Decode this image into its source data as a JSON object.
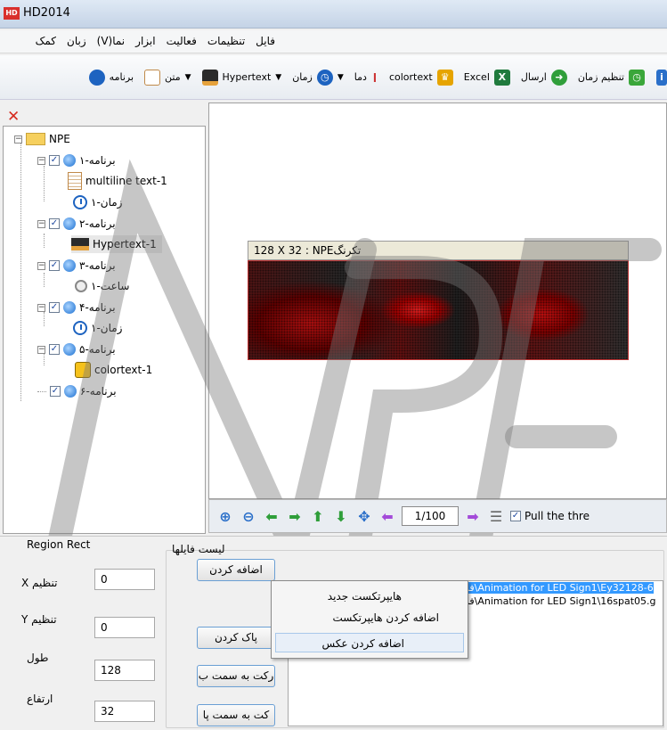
{
  "window": {
    "title": "HD2014",
    "icon_text": "HD"
  },
  "menu": [
    "فایل",
    "تنظیمات",
    "فعالیت",
    "ابزار",
    "نما(V)",
    "زبان",
    "کمک"
  ],
  "toolbar": [
    {
      "label": "تنظیم زمان",
      "icon": "clock-setting-icon",
      "color": "#3aa63a"
    },
    {
      "label": "ارسال",
      "icon": "send-icon",
      "color": "#2f9e3a"
    },
    {
      "label": "Excel",
      "icon": "excel-icon",
      "color": "#1f7a3d"
    },
    {
      "label": "colortext",
      "icon": "colortext-icon",
      "color": "#e6a400"
    },
    {
      "label": "دما",
      "icon": "thermometer-icon",
      "color": "#888888"
    },
    {
      "label": "زمان",
      "icon": "time-icon",
      "color": "#1d63c0"
    },
    {
      "label": "Hypertext",
      "icon": "hypertext-icon",
      "color": "#2b2b2b"
    },
    {
      "label": "متن",
      "icon": "text-icon",
      "color": "#c08a4a"
    },
    {
      "label": "برنامه",
      "icon": "program-icon",
      "color": "#1d63c0"
    }
  ],
  "tree": {
    "root": "NPE",
    "programs": [
      {
        "label": "برنامه-۱",
        "child": "multiline text-1",
        "child2": "زمان-۱"
      },
      {
        "label": "برنامه-۲",
        "child": "Hypertext-1"
      },
      {
        "label": "برنامه-۳",
        "child": "ساعت-۱"
      },
      {
        "label": "برنامه-۴",
        "child": "زمان-۱"
      },
      {
        "label": "برنامه-۵",
        "child": "colortext-1"
      },
      {
        "label": "برنامه-۶"
      }
    ]
  },
  "preview": {
    "header": "128 X 32 : NPEتکرنگ"
  },
  "nav": {
    "page": "1/100",
    "pull_label": "Pull the thre",
    "pull_checked": true
  },
  "region": {
    "title": "Region Rect",
    "x_label": "تنظیم X",
    "x_value": "0",
    "y_label": "تنظیم Y",
    "y_value": "0",
    "w_label": "طول",
    "w_value": "128",
    "h_label": "ارتفاع",
    "h_value": "32"
  },
  "files": {
    "title": "لیست فایلها",
    "buttons": [
      "اضافه کردن",
      "پاک کردن",
      "رکت به سمت ب",
      "کت به سمت پا"
    ],
    "items": [
      "فا\\Animation for LED Sign1\\Ey32128-6",
      "فا\\Animation for LED Sign1\\16spat05.g"
    ]
  },
  "context_menu": [
    "هایپرتکست جدید",
    "اضافه کردن هایپرتکست",
    "اضافه کردن عکس"
  ],
  "watermark_text": "NPE"
}
